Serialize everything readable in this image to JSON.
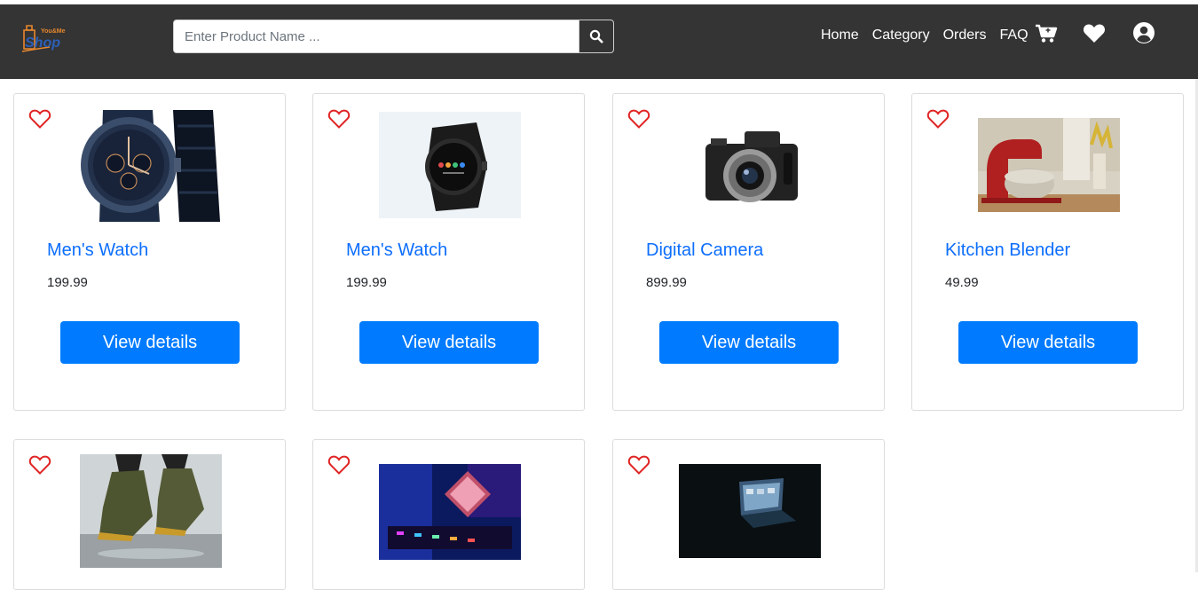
{
  "brand": {
    "logo_top": "You&Me",
    "logo_main": "Shop"
  },
  "search": {
    "placeholder": "Enter Product Name ..."
  },
  "nav": {
    "home": "Home",
    "category": "Category",
    "orders": "Orders",
    "faq": "FAQ"
  },
  "icons": {
    "search": "search-icon",
    "cart": "cart-icon",
    "wishlist": "heart-icon",
    "account": "user-circle-icon"
  },
  "colors": {
    "navbar": "#343434",
    "link": "#0d6efd",
    "button": "#007bff",
    "heart": "#e02424"
  },
  "products": [
    {
      "name": "Men's Watch",
      "price": "199.99",
      "button": "View details"
    },
    {
      "name": "Men's Watch",
      "price": "199.99",
      "button": "View details"
    },
    {
      "name": "Digital Camera",
      "price": "899.99",
      "button": "View details"
    },
    {
      "name": "Kitchen Blender",
      "price": "49.99",
      "button": "View details"
    }
  ]
}
